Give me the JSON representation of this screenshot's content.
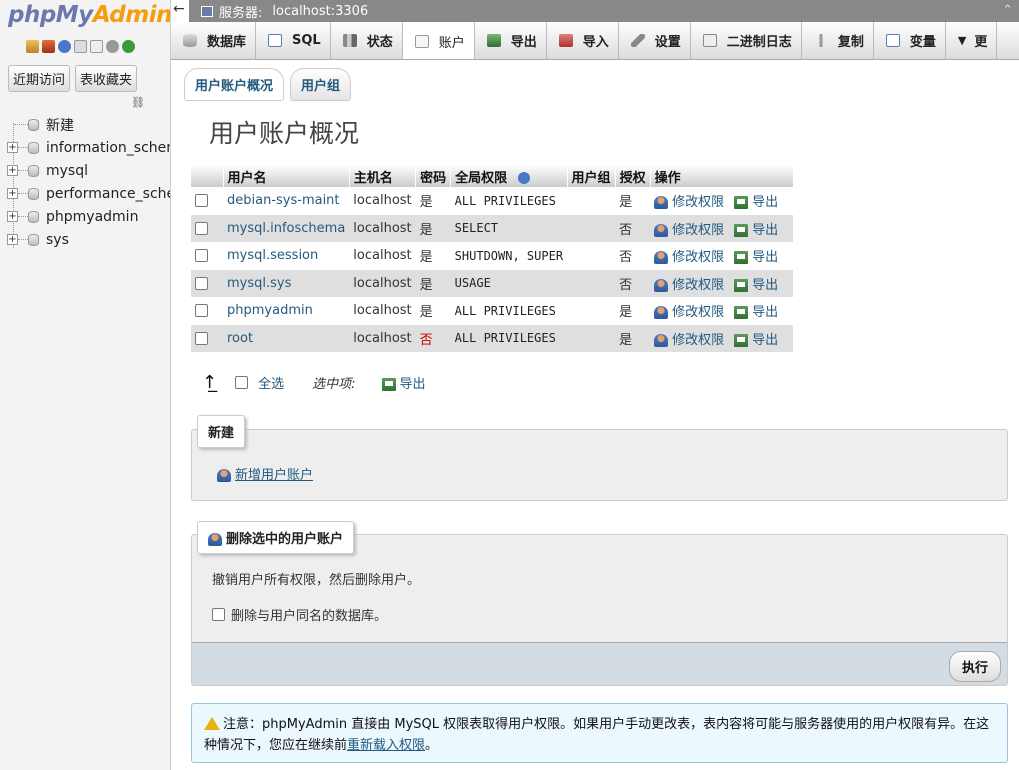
{
  "app": {
    "logo_part1": "phpMy",
    "logo_part2": "Admin"
  },
  "nav": {
    "recent_button": "近期访问",
    "favorites_button": "表收藏夹",
    "tree": [
      {
        "label": "新建"
      },
      {
        "label": "information_schema"
      },
      {
        "label": "mysql"
      },
      {
        "label": "performance_schema"
      },
      {
        "label": "phpmyadmin"
      },
      {
        "label": "sys"
      }
    ]
  },
  "topbar": {
    "server_label": "服务器:",
    "server_value": "localhost:3306"
  },
  "tabs": [
    {
      "label": "数据库"
    },
    {
      "label": "SQL"
    },
    {
      "label": "状态"
    },
    {
      "label": "账户"
    },
    {
      "label": "导出"
    },
    {
      "label": "导入"
    },
    {
      "label": "设置"
    },
    {
      "label": "二进制日志"
    },
    {
      "label": "复制"
    },
    {
      "label": "变量"
    },
    {
      "label": "更"
    }
  ],
  "subtabs": {
    "overview": "用户账户概况",
    "groups": "用户组"
  },
  "page_title": "用户账户概况",
  "table": {
    "headers": {
      "username": "用户名",
      "host": "主机名",
      "password": "密码",
      "privileges": "全局权限",
      "group": "用户组",
      "grant": "授权",
      "action": "操作"
    },
    "action_edit": "修改权限",
    "action_export": "导出",
    "rows": [
      {
        "username": "debian-sys-maint",
        "host": "localhost",
        "password": "是",
        "privileges": "ALL PRIVILEGES",
        "grant": "是"
      },
      {
        "username": "mysql.infoschema",
        "host": "localhost",
        "password": "是",
        "privileges": "SELECT",
        "grant": "否"
      },
      {
        "username": "mysql.session",
        "host": "localhost",
        "password": "是",
        "privileges": "SHUTDOWN, SUPER",
        "grant": "否"
      },
      {
        "username": "mysql.sys",
        "host": "localhost",
        "password": "是",
        "privileges": "USAGE",
        "grant": "否"
      },
      {
        "username": "phpmyadmin",
        "host": "localhost",
        "password": "是",
        "privileges": "ALL PRIVILEGES",
        "grant": "是"
      },
      {
        "username": "root",
        "host": "localhost",
        "password": "否",
        "privileges": "ALL PRIVILEGES",
        "grant": "是"
      }
    ]
  },
  "bulk": {
    "select_all": "全选",
    "with_selected": "选中项:",
    "export": "导出"
  },
  "new_section": {
    "legend": "新建",
    "add_user": "新增用户账户"
  },
  "delete_section": {
    "legend": "删除选中的用户账户",
    "description": "撤销用户所有权限，然后删除用户。",
    "drop_db_label": "删除与用户同名的数据库。",
    "go_button": "执行"
  },
  "notice": {
    "text_before": "注意：phpMyAdmin 直接由 MySQL 权限表取得用户权限。如果用户手动更改表，表内容将可能与服务器使用的用户权限有异。在这种情况下，您应在继续前",
    "link": "重新载入权限",
    "text_after": "。"
  },
  "colors": {
    "link": "#235a81",
    "logo_blue": "#6c78af",
    "logo_orange": "#f89c0e",
    "no_red": "#cc0000"
  }
}
